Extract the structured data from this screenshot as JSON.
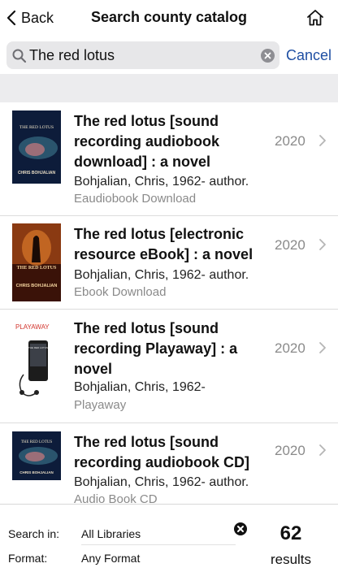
{
  "header": {
    "back_label": "Back",
    "title": "Search county catalog"
  },
  "search": {
    "query": "The red lotus",
    "cancel_label": "Cancel"
  },
  "results": [
    {
      "title": "The red lotus [sound recording audiobook download] : a novel",
      "author": "Bohjalian, Chris, 1962- author.",
      "format": "Eaudiobook Download",
      "year": "2020",
      "cover_title": "THE RED LOTUS",
      "cover_author": "CHRIS BOHJALIAN"
    },
    {
      "title": "The red lotus [electronic resource eBook] : a novel",
      "author": "Bohjalian, Chris, 1962- author.",
      "format": "Ebook Download",
      "year": "2020",
      "cover_title": "THE RED LOTUS",
      "cover_author": "CHRIS BOHJALIAN"
    },
    {
      "title": "The red lotus [sound recording Playaway] : a novel",
      "author": "Bohjalian, Chris, 1962-",
      "format": "Playaway",
      "year": "2020",
      "cover_title": "THE RED LOTUS",
      "cover_brand": "PLAYAWAY"
    },
    {
      "title": "The red lotus [sound recording audiobook CD]",
      "author": "Bohjalian, Chris, 1962- author.",
      "format": "Audio Book CD",
      "year": "2020",
      "cover_title": "THE RED LOTUS",
      "cover_author": "CHRIS BOHJALIAN"
    }
  ],
  "footer": {
    "search_in_label": "Search in:",
    "search_in_value": "All Libraries",
    "format_label": "Format:",
    "format_value": "Any Format",
    "result_count": "62",
    "results_label": "results"
  },
  "colors": {
    "accent": "#1f4fa3",
    "search_bg": "#e7e7e9",
    "band_bg": "#ececee",
    "secondary_text": "#8a8a8a"
  },
  "icons": [
    "chevron-left-icon",
    "home-icon",
    "search-icon",
    "clear-icon",
    "chevron-right-icon",
    "close-icon"
  ]
}
